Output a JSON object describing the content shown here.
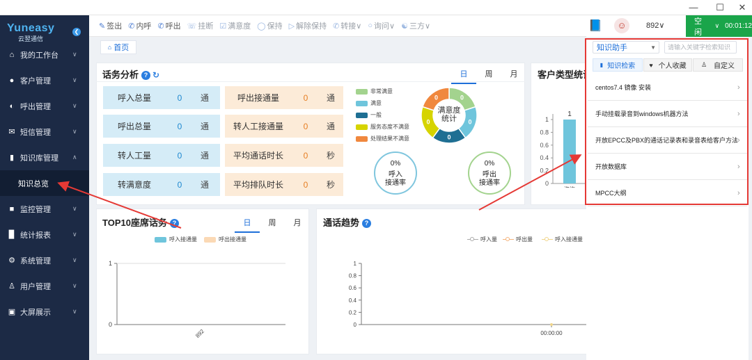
{
  "window": {
    "minimize_icon": "minimize-icon",
    "maximize_icon": "maximize-icon",
    "close_icon": "close-icon"
  },
  "brand": {
    "name": "Yuneasy",
    "subtitle": "云翌通信"
  },
  "sidebar": {
    "items": [
      {
        "label": "我的工作台",
        "icon": "home-icon"
      },
      {
        "label": "客户管理",
        "icon": "users-icon"
      },
      {
        "label": "呼出管理",
        "icon": "headset-icon"
      },
      {
        "label": "短信管理",
        "icon": "mail-icon"
      },
      {
        "label": "知识库管理",
        "icon": "books-icon",
        "expanded": true
      },
      {
        "label": "监控管理",
        "icon": "video-icon"
      },
      {
        "label": "统计报表",
        "icon": "bar-chart-icon"
      },
      {
        "label": "系统管理",
        "icon": "gear-icon"
      },
      {
        "label": "用户管理",
        "icon": "user-icon"
      },
      {
        "label": "大屏展示",
        "icon": "screen-icon"
      }
    ],
    "subitem": "知识总览"
  },
  "toolbar": {
    "items": [
      {
        "label": "签出",
        "icon": "pen-icon",
        "enabled": true
      },
      {
        "label": "内呼",
        "icon": "phone-icon",
        "enabled": true
      },
      {
        "label": "呼出",
        "icon": "phone-out-icon",
        "enabled": true
      },
      {
        "label": "挂断",
        "icon": "hangup-icon",
        "enabled": false
      },
      {
        "label": "满意度",
        "icon": "thumb-icon",
        "enabled": false
      },
      {
        "label": "保持",
        "icon": "hold-icon",
        "enabled": false
      },
      {
        "label": "解除保持",
        "icon": "play-icon",
        "enabled": false
      },
      {
        "label": "转接",
        "icon": "transfer-icon",
        "enabled": false,
        "dropdown": true
      },
      {
        "label": "询问",
        "icon": "ask-icon",
        "enabled": false,
        "dropdown": true
      },
      {
        "label": "三方",
        "icon": "three-icon",
        "enabled": false,
        "dropdown": true
      }
    ],
    "extension": "892",
    "status": "空闲",
    "timer": "00:01:12"
  },
  "breadcrumb": {
    "home": "首页"
  },
  "traffic": {
    "title": "话务分析",
    "tabs": [
      "日",
      "周",
      "月"
    ],
    "active_tab": "日",
    "cells": [
      {
        "label": "呼入总量",
        "value": "0",
        "unit": "通",
        "tone": "blue"
      },
      {
        "label": "呼出接通量",
        "value": "0",
        "unit": "通",
        "tone": "peach"
      },
      {
        "label": "呼出总量",
        "value": "0",
        "unit": "通",
        "tone": "blue"
      },
      {
        "label": "转人工接通量",
        "value": "0",
        "unit": "通",
        "tone": "peach"
      },
      {
        "label": "转人工量",
        "value": "0",
        "unit": "通",
        "tone": "blue"
      },
      {
        "label": "平均通话时长",
        "value": "0",
        "unit": "秒",
        "tone": "peach"
      },
      {
        "label": "转满意度",
        "value": "0",
        "unit": "通",
        "tone": "blue"
      },
      {
        "label": "平均排队时长",
        "value": "0",
        "unit": "秒",
        "tone": "peach"
      }
    ],
    "satisfaction_legend": [
      {
        "label": "非常满意",
        "color": "#a3d38e"
      },
      {
        "label": "满意",
        "color": "#6fc5dc"
      },
      {
        "label": "一般",
        "color": "#1f6f93"
      },
      {
        "label": "服务态度不满意",
        "color": "#d6d400"
      },
      {
        "label": "处理结果不满意",
        "color": "#f0883e"
      }
    ],
    "donut_center": [
      "满意度",
      "统计"
    ],
    "donut_values": [
      "0",
      "0",
      "0",
      "0",
      "0"
    ],
    "inbound_rate": {
      "value": "0%",
      "label": [
        "呼入",
        "接通率"
      ]
    },
    "outbound_rate": {
      "value": "0%",
      "label": [
        "呼出",
        "接通率"
      ]
    }
  },
  "customer_type": {
    "title": "客户类型统计",
    "y_ticks": [
      "1",
      "0.8",
      "0.6",
      "0.4",
      "0.2",
      "0"
    ],
    "bar_value_label": "1",
    "category": "咨询"
  },
  "top10": {
    "title": "TOP10座席话务",
    "tabs": [
      "日",
      "周",
      "月"
    ],
    "active_tab": "日",
    "legend": [
      {
        "label": "呼入接通量",
        "color": "#6fc5dc"
      },
      {
        "label": "呼出接通量",
        "color": "#fbd9b5"
      }
    ],
    "y_ticks": [
      "1",
      "0"
    ],
    "x_label": "892"
  },
  "trend": {
    "title": "通话趋势",
    "legend": [
      {
        "label": "呼入量",
        "color": "#aaaaaa"
      },
      {
        "label": "呼出量",
        "color": "#f4b27a"
      },
      {
        "label": "呼入接通量",
        "color": "#f0d58a"
      }
    ],
    "y_ticks": [
      "1",
      "0.8",
      "0.6",
      "0.4",
      "0.2",
      "0"
    ],
    "x_label": "00:00:00"
  },
  "chart_data": [
    {
      "type": "bar",
      "title": "客户类型统计",
      "categories": [
        "咨询"
      ],
      "values": [
        1
      ],
      "ylim": [
        0,
        1.1
      ]
    },
    {
      "type": "bar",
      "title": "TOP10座席话务",
      "categories": [
        "892"
      ],
      "series": [
        {
          "name": "呼入接通量",
          "values": [
            0
          ]
        },
        {
          "name": "呼出接通量",
          "values": [
            0
          ]
        }
      ],
      "ylim": [
        0,
        1
      ]
    },
    {
      "type": "line",
      "title": "通话趋势",
      "x": [
        "00:00:00"
      ],
      "series": [
        {
          "name": "呼入量",
          "values": [
            0
          ]
        },
        {
          "name": "呼出量",
          "values": [
            0
          ]
        },
        {
          "name": "呼入接通量",
          "values": [
            0
          ]
        }
      ],
      "ylim": [
        0,
        1
      ]
    }
  ],
  "assistant": {
    "selector": "知识助手",
    "search_placeholder": "请输入关键字检索知识",
    "tabs": [
      "知识检索",
      "个人收藏",
      "自定义"
    ],
    "articles": [
      "centos7.4 镜像 安装",
      "手动挂载录音到windows机器方法",
      "开放EPCC及PBX的通话记录表和录音表给客户方法",
      "开放数据库",
      "MPCC大纲"
    ]
  }
}
